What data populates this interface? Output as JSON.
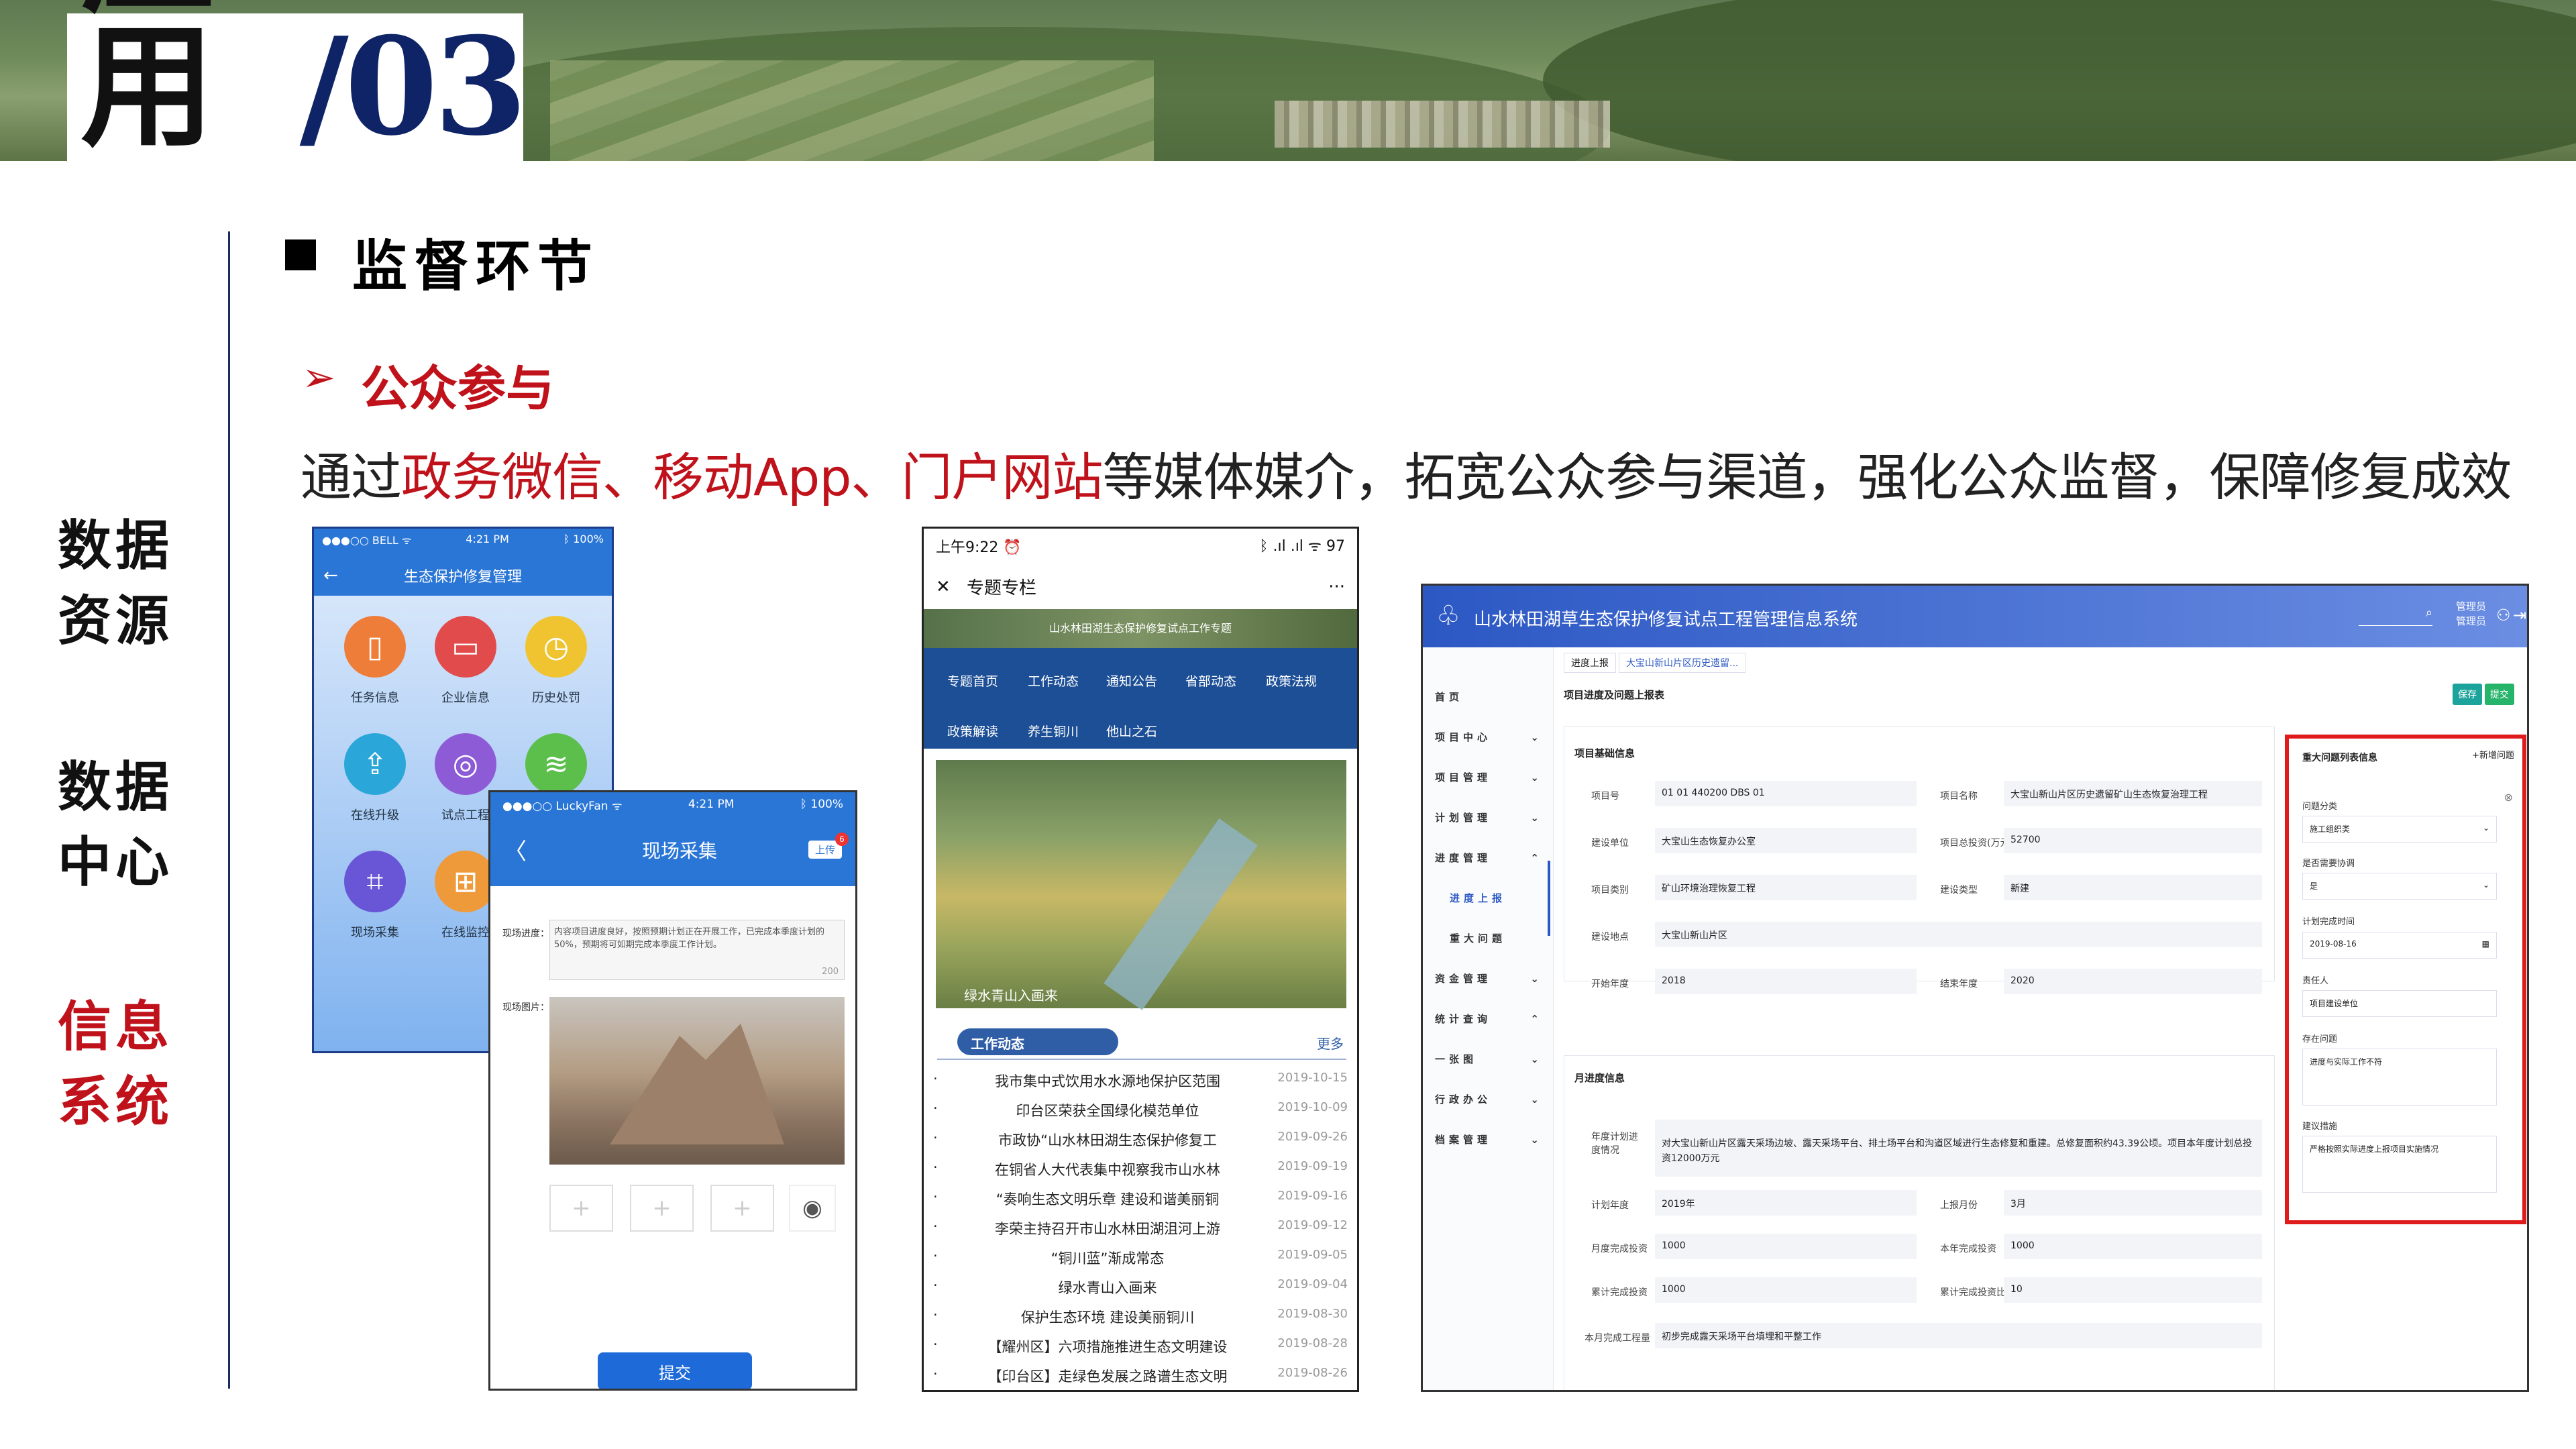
{
  "slide": {
    "title_app": "应用",
    "title_num": "/03",
    "side_labels": [
      [
        "数据",
        "资源"
      ],
      [
        "数据",
        "中心"
      ],
      [
        "信息",
        "系统"
      ]
    ],
    "heading": "监督环节",
    "subheading": "公众参与",
    "description_parts": [
      {
        "text": "通过",
        "red": false
      },
      {
        "text": "政务微信、移动App、门户网站",
        "red": true
      },
      {
        "text": "等媒体媒介，拓宽公众参与渠道，强化公众监督，保障修复成效",
        "red": false
      }
    ]
  },
  "phone1": {
    "status_left": "●●●○○ BELL ᯤ",
    "status_time": "4:21 PM",
    "status_right": "ᛒ 100%",
    "back": "←",
    "title": "生态保护修复管理",
    "tiles": [
      {
        "label": "任务信息",
        "color": "#ef7d3a",
        "glyph": "▯"
      },
      {
        "label": "企业信息",
        "color": "#e24b4b",
        "glyph": "▭"
      },
      {
        "label": "历史处罚",
        "color": "#f0c430",
        "glyph": "◷"
      },
      {
        "label": "在线升级",
        "color": "#2aa7d8",
        "glyph": "⇪"
      },
      {
        "label": "试点工程",
        "color": "#8e5bd6",
        "glyph": "◎"
      },
      {
        "label": "",
        "color": "#5cbf4c",
        "glyph": "≋"
      },
      {
        "label": "现场采集",
        "color": "#6856d6",
        "glyph": "⌗"
      },
      {
        "label": "在线监控",
        "color": "#ef9a3a",
        "glyph": "⊞"
      }
    ]
  },
  "phone2": {
    "status_left": "●●●○○ LuckyFan ᯤ",
    "status_time": "4:21 PM",
    "status_right": "ᛒ 100%",
    "back": "〈",
    "title": "现场采集",
    "upload": "上传",
    "badge": "6",
    "progress_label": "现场进度：",
    "progress_text": "内容项目进度良好，按照预期计划正在开展工作，已完成本季度计划的50%，预期将可如期完成本季度工作计划。",
    "char_count": "200",
    "photo_label": "现场图片：",
    "add_glyph": "+",
    "camera_glyph": "◉",
    "submit": "提交"
  },
  "phone3": {
    "status_left": "上午9:22 ⏰",
    "status_right": "ᛒ .ıl .ıl ᯤ 97",
    "close": "✕",
    "title": "专题专栏",
    "more": "···",
    "banner": "山水林田湖生态保护修复试点工作专题",
    "menu": [
      "专题首页",
      "工作动态",
      "通知公告",
      "省部动态",
      "政策法规",
      "政策解读",
      "养生铜川",
      "他山之石"
    ],
    "hero_caption": "绿水青山入画来",
    "section": "工作动态",
    "section_more": "更多",
    "news": [
      {
        "t": "我市集中式饮用水水源地保护区范围",
        "d": "2019-10-15"
      },
      {
        "t": "印台区荣获全国绿化模范单位",
        "d": "2019-10-09"
      },
      {
        "t": "市政协“山水林田湖生态保护修复工",
        "d": "2019-09-26"
      },
      {
        "t": "在铜省人大代表集中视察我市山水林",
        "d": "2019-09-19"
      },
      {
        "t": "“奏响生态文明乐章 建设和谐美丽铜",
        "d": "2019-09-16"
      },
      {
        "t": "李荣主持召开市山水林田湖沮河上游",
        "d": "2019-09-12"
      },
      {
        "t": "“铜川蓝”渐成常态",
        "d": "2019-09-05"
      },
      {
        "t": "绿水青山入画来",
        "d": "2019-09-04"
      },
      {
        "t": "保护生态环境 建设美丽铜川",
        "d": "2019-08-30"
      },
      {
        "t": "【耀州区】六项措施推进生态文明建设",
        "d": "2019-08-28"
      },
      {
        "t": "【印台区】走绿色发展之路谱生态文明",
        "d": "2019-08-26"
      }
    ]
  },
  "webapp": {
    "logo_glyph": "♧",
    "title": "山水林田湖草生态保护修复试点工程管理信息系统",
    "search_glyph": "⌕",
    "user_lines": [
      "管理员",
      "管理员"
    ],
    "user_glyph": "⚇",
    "exit_glyph": "⇥",
    "sidebar": [
      {
        "label": "首页",
        "arrow": "",
        "active": false
      },
      {
        "label": "项目中心",
        "arrow": "⌄",
        "active": false
      },
      {
        "label": "项目管理",
        "arrow": "⌄",
        "active": false
      },
      {
        "label": "计划管理",
        "arrow": "⌄",
        "active": false
      },
      {
        "label": "进度管理",
        "arrow": "⌃",
        "active": false
      },
      {
        "label": "进度上报",
        "arrow": "",
        "active": true
      },
      {
        "label": "重大问题",
        "arrow": "",
        "active": false
      },
      {
        "label": "资金管理",
        "arrow": "⌄",
        "active": false
      },
      {
        "label": "统计查询",
        "arrow": "⌃",
        "active": false
      },
      {
        "label": "一张图",
        "arrow": "⌄",
        "active": false
      },
      {
        "label": "行政办公",
        "arrow": "⌄",
        "active": false
      },
      {
        "label": "档案管理",
        "arrow": "⌄",
        "active": false
      }
    ],
    "tabs": [
      "进度上报",
      "大宝山新山片区历史遗留..."
    ],
    "page_title": "项目进度及问题上报表",
    "buttons": [
      "保存",
      "提交"
    ],
    "basic_title": "项目基础信息",
    "basic_fields": [
      {
        "l1": "项目号",
        "v1": "01 01 440200 DBS 01",
        "l2": "项目名称",
        "v2": "大宝山新山片区历史遗留矿山生态恢复治理工程"
      },
      {
        "l1": "建设单位",
        "v1": "大宝山生态恢复办公室",
        "l2": "项目总投资(万元)",
        "v2": "52700"
      },
      {
        "l1": "项目类别",
        "v1": "矿山环境治理恢复工程",
        "l2": "建设类型",
        "v2": "新建"
      },
      {
        "l1": "建设地点",
        "v1": "大宝山新山片区",
        "l2": "",
        "v2": ""
      },
      {
        "l1": "开始年度",
        "v1": "2018",
        "l2": "结束年度",
        "v2": "2020"
      }
    ],
    "progress_title": "月进度信息",
    "annual_label": "年度计划进度情况",
    "annual_text": "对大宝山新山片区露天采场边坡、露天采场平台、排土场平台和沟道区域进行生态修复和重建。总修复面积约43.39公顷。项目本年度计划总投资12000万元",
    "progress_fields": [
      {
        "l1": "计划年度",
        "v1": "2019年",
        "l2": "上报月份",
        "v2": "3月"
      },
      {
        "l1": "月度完成投资",
        "v1": "1000",
        "l2": "本年完成投资",
        "v2": "1000"
      },
      {
        "l1": "累计完成投资",
        "v1": "1000",
        "l2": "累计完成投资比率（%）",
        "v2": "10"
      }
    ],
    "monthly_label": "本月完成工程量",
    "monthly_text": "初步完成露天采场平台填埋和平整工作",
    "issue_panel": {
      "title": "重大问题列表信息",
      "add": "+新增问题",
      "close_glyph": "⊗",
      "category_label": "问题分类",
      "category_value": "施工组织类",
      "related_label": "是否需要协调",
      "related_value": "是",
      "plan_time_label": "计划完成时间",
      "plan_time_value": "2019-08-16",
      "resp_label": "责任人",
      "resp_value": "项目建设单位",
      "issue_label": "存在问题",
      "issue_value": "进度与实际工作不符",
      "advice_label": "建议措施",
      "advice_value": "严格按照实际进度上报项目实施情况",
      "select_glyph": "⌄",
      "cal_glyph": "▦"
    }
  }
}
